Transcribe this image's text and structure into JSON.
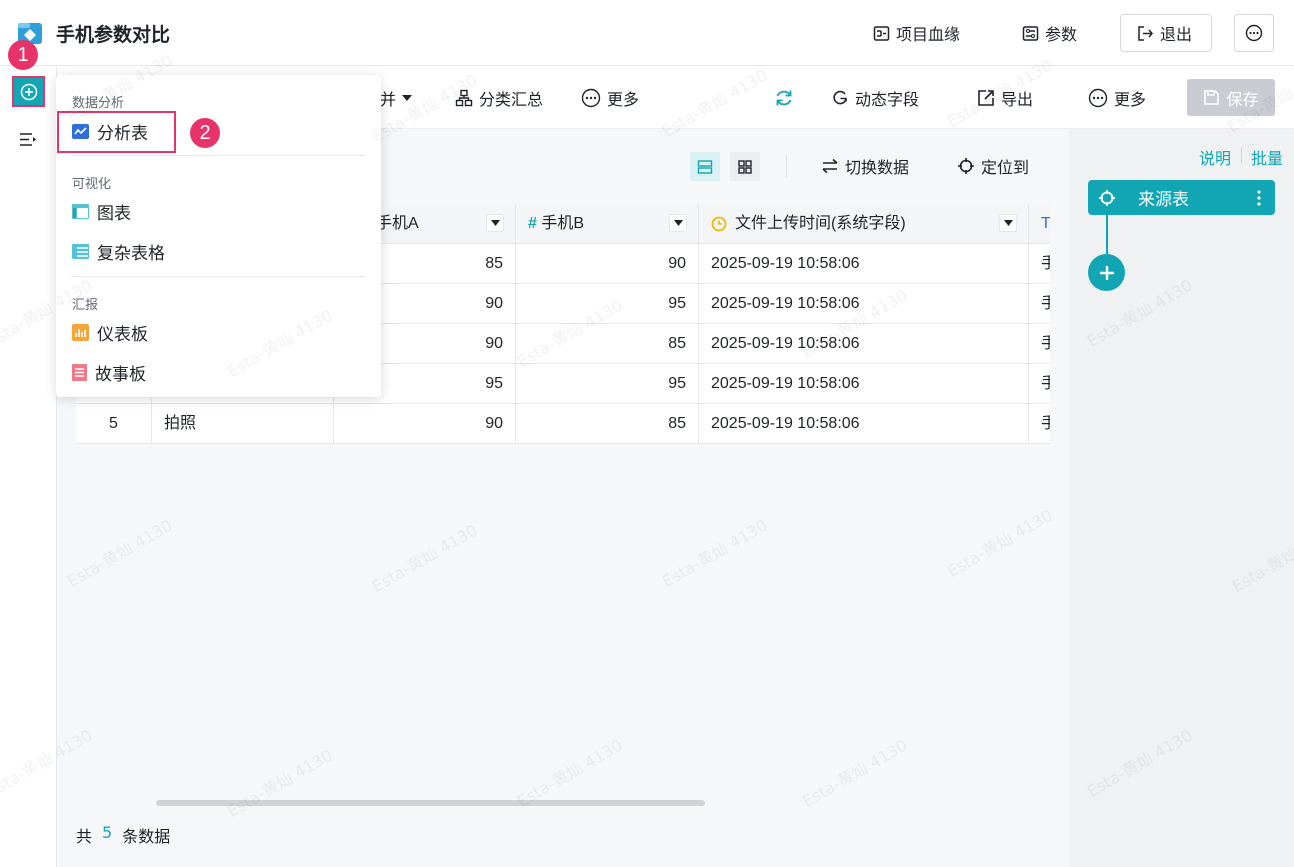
{
  "header": {
    "title": "手机参数对比",
    "lineage_label": "项目血缘",
    "params_label": "参数",
    "exit_label": "退出"
  },
  "toolbar": {
    "merge_label": "并",
    "group_summary_label": "分类汇总",
    "more_label": "更多",
    "dynamic_field_label": "动态字段",
    "export_label": "导出",
    "more2_label": "更多",
    "save_label": "保存"
  },
  "subtoolbar": {
    "switch_data_label": "切换数据",
    "locate_label": "定位到"
  },
  "table": {
    "columns": [
      "",
      "",
      "手机A",
      "手机B",
      "文件上传时间(系统字段)",
      "手"
    ],
    "rows": [
      {
        "a": "85",
        "b": "90",
        "time": "2025-09-19 10:58:06",
        "extra": "手"
      },
      {
        "a": "90",
        "b": "95",
        "time": "2025-09-19 10:58:06",
        "extra": "手"
      },
      {
        "a": "90",
        "b": "85",
        "time": "2025-09-19 10:58:06",
        "extra": "手"
      },
      {
        "a": "95",
        "b": "95",
        "time": "2025-09-19 10:58:06",
        "extra": "手"
      },
      {
        "idx": "5",
        "name": "拍照",
        "a": "90",
        "b": "85",
        "time": "2025-09-19 10:58:06",
        "extra": "手"
      }
    ]
  },
  "footer": {
    "prefix": "共",
    "count": "5",
    "suffix": "条数据"
  },
  "right_panel": {
    "explain_label": "说明",
    "batch_label": "批量",
    "source_node_label": "来源表"
  },
  "menu": {
    "sections": [
      {
        "title": "数据分析",
        "items": [
          {
            "label": "分析表",
            "icon": "analysis-table-icon"
          }
        ]
      },
      {
        "title": "可视化",
        "items": [
          {
            "label": "图表",
            "icon": "chart-icon"
          },
          {
            "label": "复杂表格",
            "icon": "complex-table-icon"
          }
        ]
      },
      {
        "title": "汇报",
        "items": [
          {
            "label": "仪表板",
            "icon": "dashboard-icon"
          },
          {
            "label": "故事板",
            "icon": "storyboard-icon"
          }
        ]
      }
    ]
  },
  "annotations": {
    "step1": "1",
    "step2": "2"
  },
  "watermark": "Esta-黄灿 4130",
  "colors": {
    "accent": "#12a5b4",
    "highlight": "#e8336a",
    "save_disabled": "#c9ccd2"
  }
}
